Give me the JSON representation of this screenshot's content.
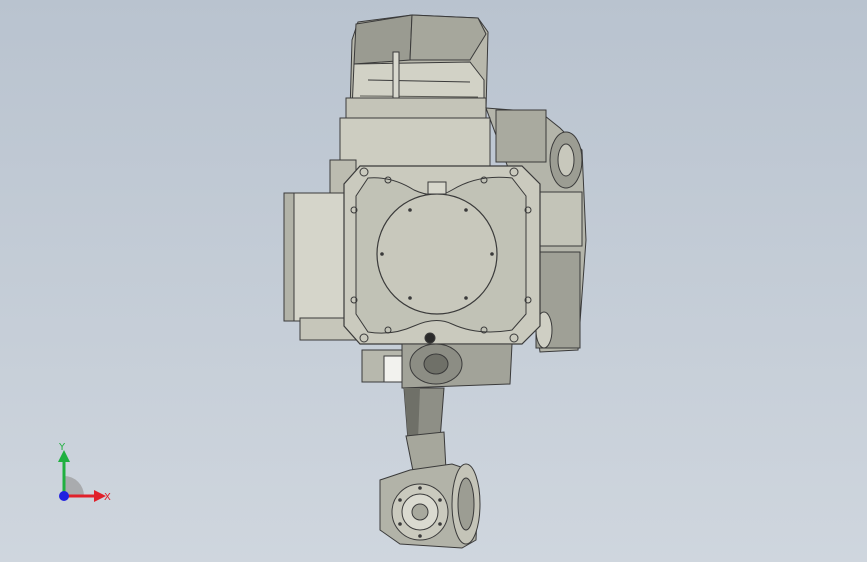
{
  "viewport": {
    "background_top": "#b9c3cf",
    "background_bottom": "#cfd6de"
  },
  "model": {
    "name": "",
    "body_color": "#c9c9bd",
    "shade_color": "#8e8f86",
    "dark_color": "#3a3a3a",
    "highlight_color": "#e2e2d8"
  },
  "triad": {
    "x_label": "X",
    "y_label": "Y",
    "x_color": "#e0202a",
    "y_color": "#20b040",
    "z_color": "#2020e0"
  }
}
